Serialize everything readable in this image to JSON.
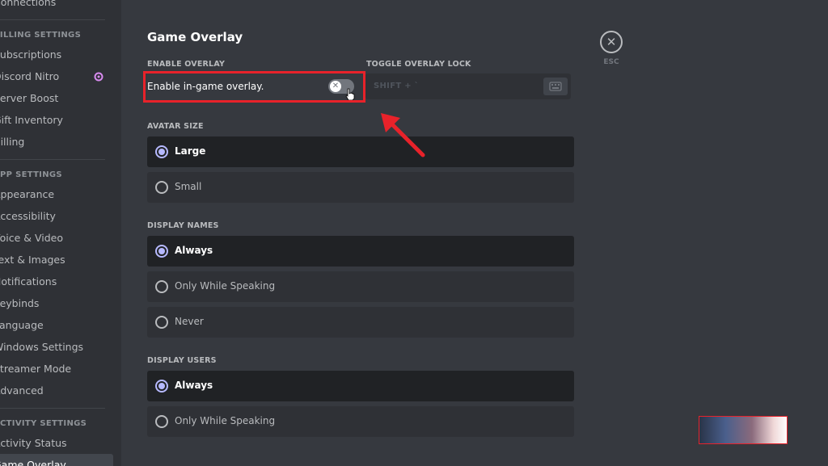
{
  "sidebar": {
    "items": [
      {
        "type": "item",
        "label": "Connections"
      },
      {
        "type": "divider"
      },
      {
        "type": "header",
        "label": "Billing Settings"
      },
      {
        "type": "item",
        "label": "Subscriptions"
      },
      {
        "type": "item",
        "label": "Discord Nitro",
        "icon": "nitro-icon"
      },
      {
        "type": "item",
        "label": "Server Boost"
      },
      {
        "type": "item",
        "label": "Gift Inventory"
      },
      {
        "type": "item",
        "label": "Billing"
      },
      {
        "type": "divider"
      },
      {
        "type": "header",
        "label": "App Settings"
      },
      {
        "type": "item",
        "label": "Appearance"
      },
      {
        "type": "item",
        "label": "Accessibility"
      },
      {
        "type": "item",
        "label": "Voice & Video"
      },
      {
        "type": "item",
        "label": "Text & Images"
      },
      {
        "type": "item",
        "label": "Notifications"
      },
      {
        "type": "item",
        "label": "Keybinds"
      },
      {
        "type": "item",
        "label": "Language"
      },
      {
        "type": "item",
        "label": "Windows Settings"
      },
      {
        "type": "item",
        "label": "Streamer Mode"
      },
      {
        "type": "item",
        "label": "Advanced"
      },
      {
        "type": "divider"
      },
      {
        "type": "header",
        "label": "Activity Settings"
      },
      {
        "type": "item",
        "label": "Activity Status"
      },
      {
        "type": "item",
        "label": "Game Overlay",
        "active": true
      }
    ]
  },
  "main": {
    "title": "Game Overlay",
    "enable_overlay": {
      "label": "Enable Overlay",
      "text": "Enable in-game overlay.",
      "enabled": false
    },
    "toggle_lock": {
      "label": "Toggle Overlay Lock",
      "keybind": "SHIFT + `"
    },
    "esc": {
      "label": "ESC"
    },
    "avatar_size": {
      "label": "Avatar Size",
      "options": [
        {
          "label": "Large",
          "selected": true
        },
        {
          "label": "Small",
          "selected": false
        }
      ]
    },
    "display_names": {
      "label": "Display Names",
      "options": [
        {
          "label": "Always",
          "selected": true
        },
        {
          "label": "Only While Speaking",
          "selected": false
        },
        {
          "label": "Never",
          "selected": false
        }
      ]
    },
    "display_users": {
      "label": "Display Users",
      "options": [
        {
          "label": "Always",
          "selected": true
        },
        {
          "label": "Only While Speaking",
          "selected": false
        }
      ]
    }
  },
  "colors": {
    "background": "#36393f",
    "sidebar": "#2f3136",
    "radio_accent": "#b6b9ff",
    "highlight": "#e8222a"
  }
}
